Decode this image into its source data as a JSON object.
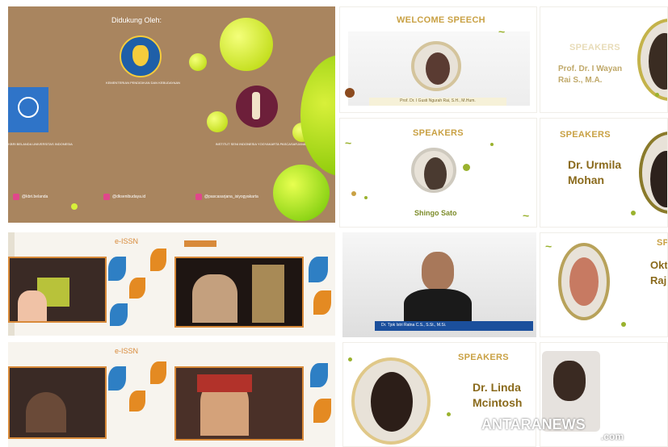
{
  "sponsor": {
    "title": "Didukung Oleh:",
    "ministry_caption": "KEMENTERIAN PENDIDIKAN DAN KEBUDAYAAN",
    "left_caption": "KBRI BELANDA\nUNIVERSITAS INDONESIA",
    "isi_caption": "INSTITUT SENI INDONESIA YOGYAKARTA\nPASCASARJANA",
    "social_1": "@kbri.belanda",
    "social_2": "@dksenibudaya.id",
    "social_3": "@pascasarjana_isiyogyakarta"
  },
  "welcome": {
    "label": "WELCOME SPEECH",
    "caption": "Prof. Dr. I Gusti Ngurah Rai, S.H., M.Hum."
  },
  "speaker_tr": {
    "label": "SPEAKERS",
    "name_line1": "Prof. Dr. I Wayan",
    "name_line2": "Rai S., M.A."
  },
  "speaker_shingo": {
    "label": "SPEAKERS",
    "name": "Shingo Sato"
  },
  "speaker_urmila": {
    "label": "SPEAKERS",
    "name_line1": "Dr. Urmila",
    "name_line2": "Mohan"
  },
  "speaker_video": {
    "caption": "Dr. Tjok Istri Ratna C.S., S.St., M.Si."
  },
  "speaker_okti": {
    "label": "SPE",
    "name_line1": "Okt",
    "name_line2": "Raj"
  },
  "speaker_linda": {
    "label": "SPEAKERS",
    "name_line1": "Dr. Linda",
    "name_line2": "Mcintosh"
  },
  "video_label": "e-ISSN",
  "watermark": {
    "line1": "ANTARANEWS",
    "line2": ".com"
  },
  "colors": {
    "brown": "#a9855f",
    "accent_gold": "#c9a144",
    "lime": "#c6e000",
    "orange_border": "#d88a3a"
  }
}
